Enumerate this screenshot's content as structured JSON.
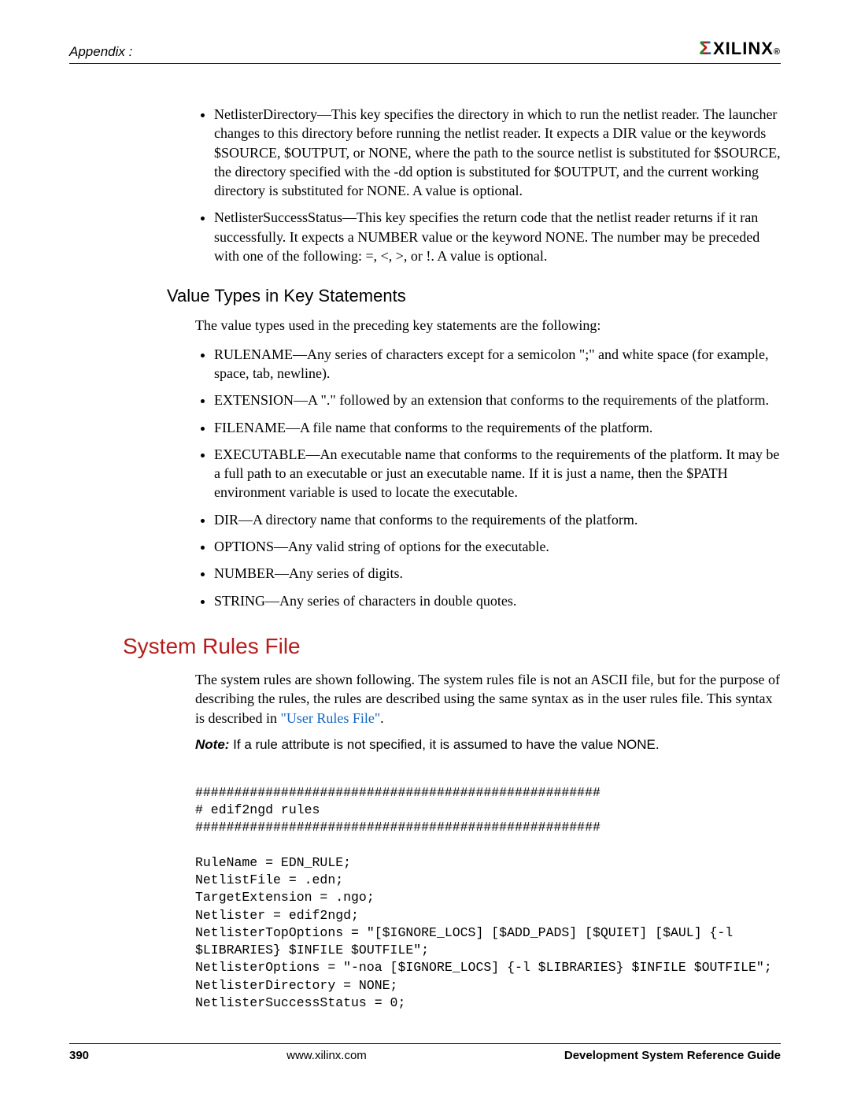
{
  "header": {
    "appendix": "Appendix :",
    "logo_text": "XILINX",
    "logo_reg": "®"
  },
  "intro_bullets": [
    "NetlisterDirectory—This key specifies the directory in which to run the netlist reader. The launcher changes to this directory before running the netlist reader. It expects a DIR value or the keywords $SOURCE, $OUTPUT, or NONE, where the path to the source netlist is substituted for $SOURCE, the directory specified with the -dd option is substituted for $OUTPUT, and the current working directory is substituted for NONE. A value is optional.",
    "NetlisterSuccessStatus—This key specifies the return code that the netlist reader returns if it ran successfully. It expects a NUMBER value or the keyword NONE. The number may be preceded with one of the following: =, <, >, or !. A value is optional."
  ],
  "section_value_types": {
    "heading": "Value Types in Key Statements",
    "intro": "The value types used in the preceding key statements are the following:",
    "bullets": [
      "RULENAME—Any series of characters except for a semicolon \";\" and white space (for example, space, tab, newline).",
      "EXTENSION—A \".\" followed by an extension that conforms to the requirements of the platform.",
      "FILENAME—A file name that conforms to the requirements of the platform.",
      "EXECUTABLE—An executable name that conforms to the requirements of the platform. It may be a full path to an executable or just an executable name. If it is just a name, then the $PATH environment variable is used to locate the executable.",
      "DIR—A directory name that conforms to the requirements of the platform.",
      "OPTIONS—Any valid string of options for the executable.",
      "NUMBER—Any series of digits.",
      "STRING—Any series of characters in double quotes."
    ]
  },
  "section_system_rules": {
    "heading": "System Rules File",
    "para_pre": "The system rules are shown following. The system rules file is not an ASCII file, but for the purpose of describing the rules, the rules are described using the same syntax as in the user rules file. This syntax is described in ",
    "para_link": "\"User Rules File\"",
    "para_post": ".",
    "note_label": "Note:",
    "note_body": "  If a rule attribute is not specified, it is assumed to have the value NONE.",
    "code": "####################################################\n# edif2ngd rules\n####################################################\n\nRuleName = EDN_RULE;\nNetlistFile = .edn;\nTargetExtension = .ngo;\nNetlister = edif2ngd;\nNetlisterTopOptions = \"[$IGNORE_LOCS] [$ADD_PADS] [$QUIET] [$AUL] {-l $LIBRARIES} $INFILE $OUTFILE\";\nNetlisterOptions = \"-noa [$IGNORE_LOCS] {-l $LIBRARIES} $INFILE $OUTFILE\";\nNetlisterDirectory = NONE;\nNetlisterSuccessStatus = 0;"
  },
  "footer": {
    "page": "390",
    "url": "www.xilinx.com",
    "doc_title": "Development System Reference Guide"
  }
}
